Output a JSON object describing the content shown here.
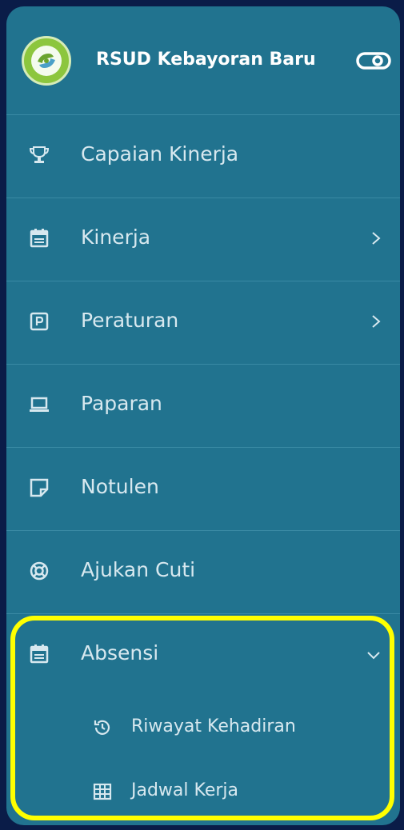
{
  "brand": {
    "title": "RSUD Kebayoran Baru",
    "logo_icon": "hospital-logo",
    "toggle_icon": "toggle-icon"
  },
  "colors": {
    "sidebar_bg": "#21738f",
    "page_bg": "#0a1c48",
    "highlight": "#ffff00",
    "text": "#d7e8ef",
    "logo_green": "#8cc63e"
  },
  "menu": [
    {
      "label": "Capaian Kinerja",
      "icon": "trophy-icon"
    },
    {
      "label": "Kinerja",
      "icon": "calendar-icon",
      "chevron": "chevron-right-icon"
    },
    {
      "label": "Peraturan",
      "icon": "parking-sign-icon",
      "chevron": "chevron-right-icon"
    },
    {
      "label": "Paparan",
      "icon": "laptop-icon"
    },
    {
      "label": "Notulen",
      "icon": "sticky-note-icon"
    },
    {
      "label": "Ajukan Cuti",
      "icon": "lifebuoy-icon"
    },
    {
      "label": "Absensi",
      "icon": "calendar-icon",
      "chevron": "chevron-down-icon",
      "expanded": true
    }
  ],
  "submenu": [
    {
      "label": "Riwayat Kehadiran",
      "icon": "history-icon"
    },
    {
      "label": "Jadwal Kerja",
      "icon": "grid-icon"
    }
  ]
}
